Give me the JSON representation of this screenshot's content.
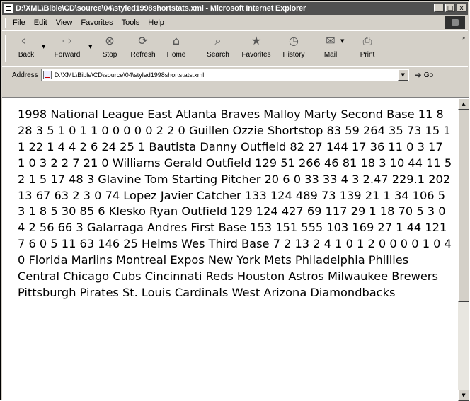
{
  "window": {
    "title": "D:\\XML\\Bible\\CD\\source\\04\\styled1998shortstats.xml - Microsoft Internet Explorer",
    "buttons": {
      "minimize": "_",
      "maximize": "□",
      "close": "x"
    }
  },
  "menu": {
    "items": [
      {
        "label": "File"
      },
      {
        "label": "Edit"
      },
      {
        "label": "View"
      },
      {
        "label": "Favorites"
      },
      {
        "label": "Tools"
      },
      {
        "label": "Help"
      }
    ]
  },
  "toolbar": {
    "buttons": [
      {
        "label": "Back",
        "icon": "back-arrow-icon",
        "glyph": "⇦"
      },
      {
        "label": "Forward",
        "icon": "forward-arrow-icon",
        "glyph": "⇨"
      },
      {
        "label": "Stop",
        "icon": "stop-icon",
        "glyph": "⊗"
      },
      {
        "label": "Refresh",
        "icon": "refresh-icon",
        "glyph": "⟳"
      },
      {
        "label": "Home",
        "icon": "home-icon",
        "glyph": "⌂"
      },
      {
        "label": "Search",
        "icon": "search-icon",
        "glyph": "⌕"
      },
      {
        "label": "Favorites",
        "icon": "favorites-icon",
        "glyph": "★"
      },
      {
        "label": "History",
        "icon": "history-icon",
        "glyph": "◷"
      },
      {
        "label": "Mail",
        "icon": "mail-icon",
        "glyph": "✉"
      },
      {
        "label": "Print",
        "icon": "print-icon",
        "glyph": "⎙"
      }
    ]
  },
  "address": {
    "label": "Address",
    "value": "D:\\XML\\Bible\\CD\\source\\04\\styled1998shortstats.xml",
    "go_label": "Go"
  },
  "document": {
    "text": "1998 National League East Atlanta Braves Malloy Marty Second Base 11 8 28 3 5 1 0 1 1 0 0 0 0 0 2 2 0 Guillen Ozzie Shortstop 83 59 264 35 73 15 1 1 22 1 4 4 2 6 24 25 1 Bautista Danny Outfield 82 27 144 17 36 11 0 3 17 1 0 3 2 2 7 21 0 Williams Gerald Outfield 129 51 266 46 81 18 3 10 44 11 5 2 1 5 17 48 3 Glavine Tom Starting Pitcher 20 6 0 33 33 4 3 2.47 229.1 202 13 67 63 2 3 0 74 Lopez Javier Catcher 133 124 489 73 139 21 1 34 106 5 3 1 8 5 30 85 6 Klesko Ryan Outfield 129 124 427 69 117 29 1 18 70 5 3 0 4 2 56 66 3 Galarraga Andres First Base 153 151 555 103 169 27 1 44 121 7 6 0 5 11 63 146 25 Helms Wes Third Base 7 2 13 2 4 1 0 1 2 0 0 0 0 1 0 4 0 Florida Marlins Montreal Expos New York Mets Philadelphia Phillies Central Chicago Cubs Cincinnati Reds Houston Astros Milwaukee Brewers Pittsburgh Pirates St. Louis Cardinals West Arizona Diamondbacks"
  },
  "scrollbar": {
    "position": 0.0
  }
}
